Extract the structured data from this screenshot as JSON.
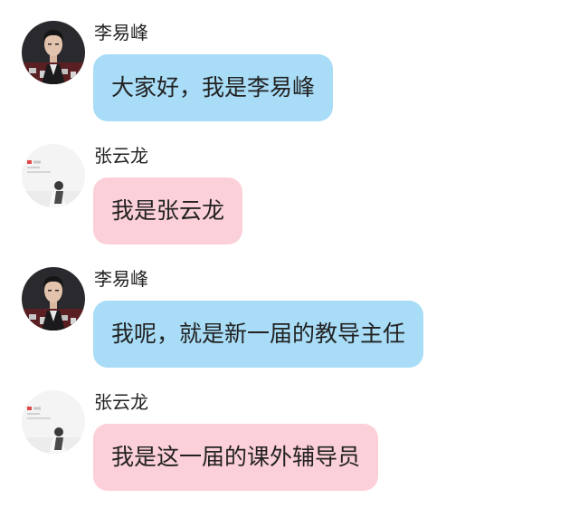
{
  "theme": {
    "blue_bubble": "#a8dcf7",
    "pink_bubble": "#fcd0d8"
  },
  "messages": [
    {
      "sender": "李易峰",
      "text": "大家好，我是李易峰",
      "avatar_icon": "li-yifeng-avatar",
      "bubble_color": "#a8dcf7"
    },
    {
      "sender": "张云龙",
      "text": "我是张云龙",
      "avatar_icon": "zhang-yunlong-avatar",
      "bubble_color": "#fcd0d8"
    },
    {
      "sender": "李易峰",
      "text": "我呢，就是新一届的教导主任",
      "avatar_icon": "li-yifeng-avatar",
      "bubble_color": "#a8dcf7"
    },
    {
      "sender": "张云龙",
      "text": "我是这一届的课外辅导员",
      "avatar_icon": "zhang-yunlong-avatar",
      "bubble_color": "#fcd0d8"
    }
  ]
}
